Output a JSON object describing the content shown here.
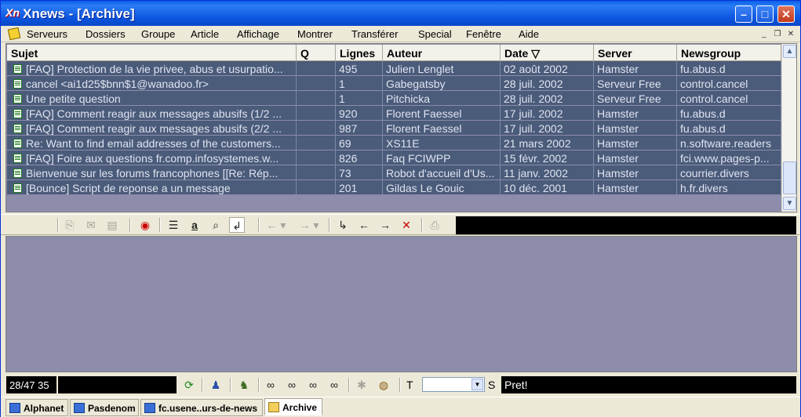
{
  "window": {
    "title": "Xnews - [Archive]",
    "app_icon_text": "Xn"
  },
  "menu": [
    "Serveurs",
    "Dossiers",
    "Groupe",
    "Article",
    "Affichage",
    "Montrer",
    "Transférer",
    "Special",
    "Fenêtre",
    "Aide"
  ],
  "table": {
    "columns": [
      "Sujet",
      "Q",
      "Lignes",
      "Auteur",
      "Date  ▽",
      "Server",
      "Newsgroup"
    ],
    "rows": [
      {
        "subject": "[FAQ] Protection de la vie privee, abus et usurpatio...",
        "q": "",
        "lines": "495",
        "author": "Julien Lenglet",
        "date": "02 août 2002",
        "server": "Hamster",
        "group": "fu.abus.d"
      },
      {
        "subject": "cancel <ai1d25$bnn$1@wanadoo.fr>",
        "q": "",
        "lines": "1",
        "author": "Gabegatsby",
        "date": "28 juil. 2002",
        "server": "Serveur Free",
        "group": "control.cancel"
      },
      {
        "subject": "Une petite question",
        "q": "",
        "lines": "1",
        "author": "Pitchicka",
        "date": "28 juil. 2002",
        "server": "Serveur Free",
        "group": "control.cancel"
      },
      {
        "subject": "[FAQ] Comment reagir aux messages abusifs (1/2 ...",
        "q": "",
        "lines": "920",
        "author": "Florent Faessel",
        "date": "17 juil. 2002",
        "server": "Hamster",
        "group": "fu.abus.d"
      },
      {
        "subject": "[FAQ] Comment reagir aux messages abusifs (2/2 ...",
        "q": "",
        "lines": "987",
        "author": "Florent Faessel",
        "date": "17 juil. 2002",
        "server": "Hamster",
        "group": "fu.abus.d"
      },
      {
        "subject": "Re: Want to find email addresses of the customers...",
        "q": "",
        "lines": "69",
        "author": "XS11E",
        "date": "21 mars 2002",
        "server": "Hamster",
        "group": "n.software.readers"
      },
      {
        "subject": "[FAQ] Foire aux questions fr.comp.infosystemes.w...",
        "q": "",
        "lines": "826",
        "author": "Faq FCIWPP",
        "date": "15 févr. 2002",
        "server": "Hamster",
        "group": "fci.www.pages-p..."
      },
      {
        "subject": "Bienvenue sur les forums francophones [[Re: Rép...",
        "q": "",
        "lines": "73",
        "author": "Robot d'accueil d'Us...",
        "date": "11 janv. 2002",
        "server": "Hamster",
        "group": "courrier.divers"
      },
      {
        "subject": "[Bounce] Script de reponse a un message",
        "q": "",
        "lines": "201",
        "author": "Gildas Le Gouic",
        "date": "10 déc. 2001",
        "server": "Hamster",
        "group": "h.fr.divers"
      }
    ]
  },
  "status": {
    "count": "28/47 35",
    "t_label": "T",
    "s_label": "S",
    "message": "Pret!"
  },
  "tabs": [
    "Alphanet",
    "Pasdenom",
    "fc.usene..urs-de-news",
    "Archive"
  ],
  "icons": {
    "toolbar": [
      "copy-icon",
      "mail-icon",
      "paste-icon",
      "xnews-logo-icon",
      "list-icon",
      "font-a-icon",
      "search-icon",
      "reply-icon",
      "back-icon",
      "forward-icon",
      "goto-icon",
      "prev-icon",
      "next-icon",
      "mark-icon",
      "print-icon"
    ],
    "status": [
      "refresh-icon",
      "users-icon",
      "spy-icon",
      "glasses1-icon",
      "glasses2-icon",
      "glasses3-icon",
      "glasses4-icon",
      "puzzle-icon",
      "globe-icon"
    ]
  }
}
